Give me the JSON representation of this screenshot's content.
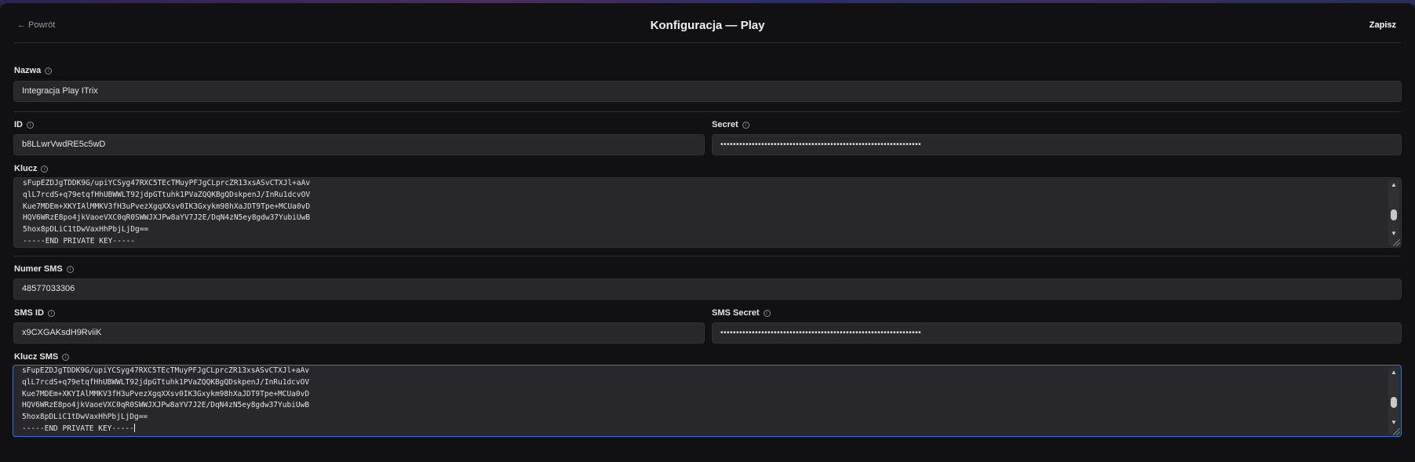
{
  "header": {
    "back_label": "← Powrót",
    "title": "Konfiguracja — Play",
    "save_label": "Zapisz"
  },
  "form": {
    "name": {
      "label": "Nazwa",
      "value": "Integracja Play ITrix"
    },
    "id": {
      "label": "ID",
      "value": "b8LLwrVwdRE5c5wD"
    },
    "secret": {
      "label": "Secret",
      "value": "••••••••••••••••••••••••••••••••••••••••••••••••••••••••••••••••"
    },
    "key": {
      "label": "Klucz",
      "value": "sFupEZDJgTDDK9G/upiYCSyg47RXC5TEcTMuyPFJgCLprcZR13xsASvCTXJl+aAv\nqlL7rcdS+q79etqfHhUBWWLT92jdpGTtuhk1PVaZQQKBgQDskpenJ/InRu1dcvOV\nKue7MDEm+XKYIAlMMKV3fH3uPvezXgqXXsv0IK3Gxykm98hXaJDT9Tpe+MCUa0vD\nHQV6WRzE8po4jkVaoeVXC0qR0SWWJXJPw8aYV7J2E/DqN4zN5ey8gdw37YubiUwB\n5hox8pDLiC1tDwVaxHhPbjLjDg==\n-----END PRIVATE KEY-----"
    },
    "sms_number": {
      "label": "Numer SMS",
      "value": "48577033306"
    },
    "sms_id": {
      "label": "SMS ID",
      "value": "x9CXGAKsdH9RviiK"
    },
    "sms_secret": {
      "label": "SMS Secret",
      "value": "••••••••••••••••••••••••••••••••••••••••••••••••••••••••••••••••"
    },
    "sms_key": {
      "label": "Klucz SMS",
      "value": "sFupEZDJgTDDK9G/upiYCSyg47RXC5TEcTMuyPFJgCLprcZR13xsASvCTXJl+aAv\nqlL7rcdS+q79etqfHhUBWWLT92jdpGTtuhk1PVaZQQKBgQDskpenJ/InRu1dcvOV\nKue7MDEm+XKYIAlMMKV3fH3uPvezXgqXXsv0IK3Gxykm98hXaJDT9Tpe+MCUa0vD\nHQV6WRzE8po4jkVaoeVXC0qR0SWWJXJPw8aYV7J2E/DqN4zN5ey8gdw37YubiUwB\n5hox8pDLiC1tDwVaxHhPbjLjDg==\n-----END PRIVATE KEY-----"
    }
  },
  "icons": {
    "info": "info-circle-icon",
    "scroll_up": "triangle-up-icon",
    "scroll_down": "triangle-down-icon",
    "resize": "resize-grip-icon"
  },
  "colors": {
    "background": "#111113",
    "field": "#28282c",
    "focus_border": "#3b74d8"
  }
}
